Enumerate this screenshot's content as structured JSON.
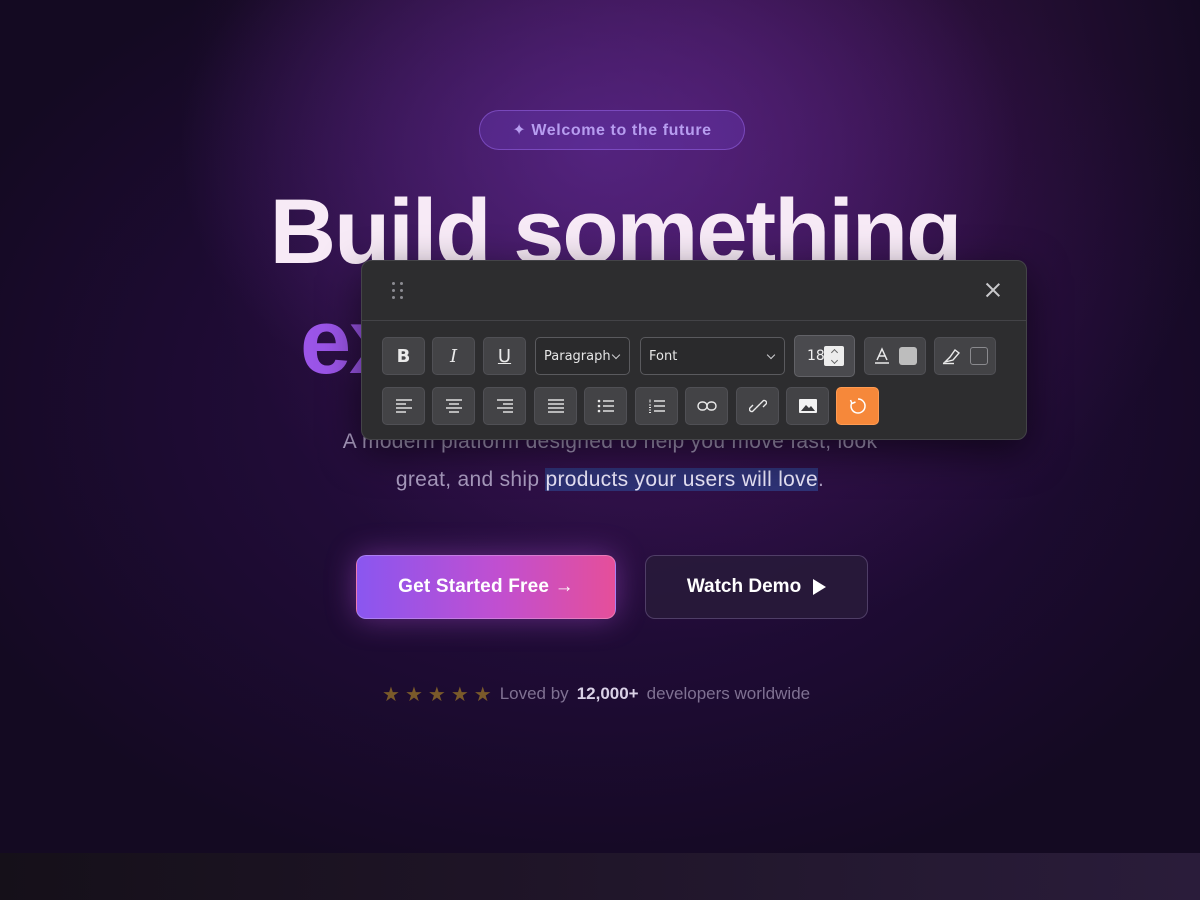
{
  "hero": {
    "badge": "✦ Welcome to the future",
    "headline_line1": "Build something",
    "headline_line2_visible": "ex",
    "subtitle_line1": "A modern platform designed to help you move fast, look",
    "subtitle_line2_before": "great, and ship ",
    "subtitle_line2_highlight": "products your users will love",
    "subtitle_line2_after": ".",
    "primary_cta": "Get Started Free →",
    "secondary_cta": "Watch Demo",
    "proof_prefix": "Loved by",
    "proof_count": "12,000+",
    "proof_suffix": "developers worldwide",
    "stars": [
      "★",
      "★",
      "★",
      "★",
      "★"
    ]
  },
  "toolbar": {
    "bold_label": "B",
    "italic_label": "I",
    "underline_label": "U",
    "block_format": "Paragraph",
    "font_family": "Font",
    "font_size": "18",
    "text_color": "#bdbdbd",
    "accent_color": "#f6883a",
    "icons": {
      "drag": "drag-handle-icon",
      "close": "close-icon",
      "text_color": "text-color-icon",
      "highlight": "highlighter-icon",
      "align_left": "align-left-icon",
      "align_center": "align-center-icon",
      "align_right": "align-right-icon",
      "justify": "align-justify-icon",
      "bullet_list": "bullet-list-icon",
      "numbered_list": "numbered-list-icon",
      "link": "link-icon",
      "unlink": "unlink-icon",
      "image": "image-icon",
      "reset": "reset-icon"
    }
  },
  "colors": {
    "brand_purple": "#9b55e8",
    "cta_gradient_start": "#8a56f0",
    "cta_gradient_end": "#e54f9a",
    "highlight_bg": "#2e3275"
  }
}
